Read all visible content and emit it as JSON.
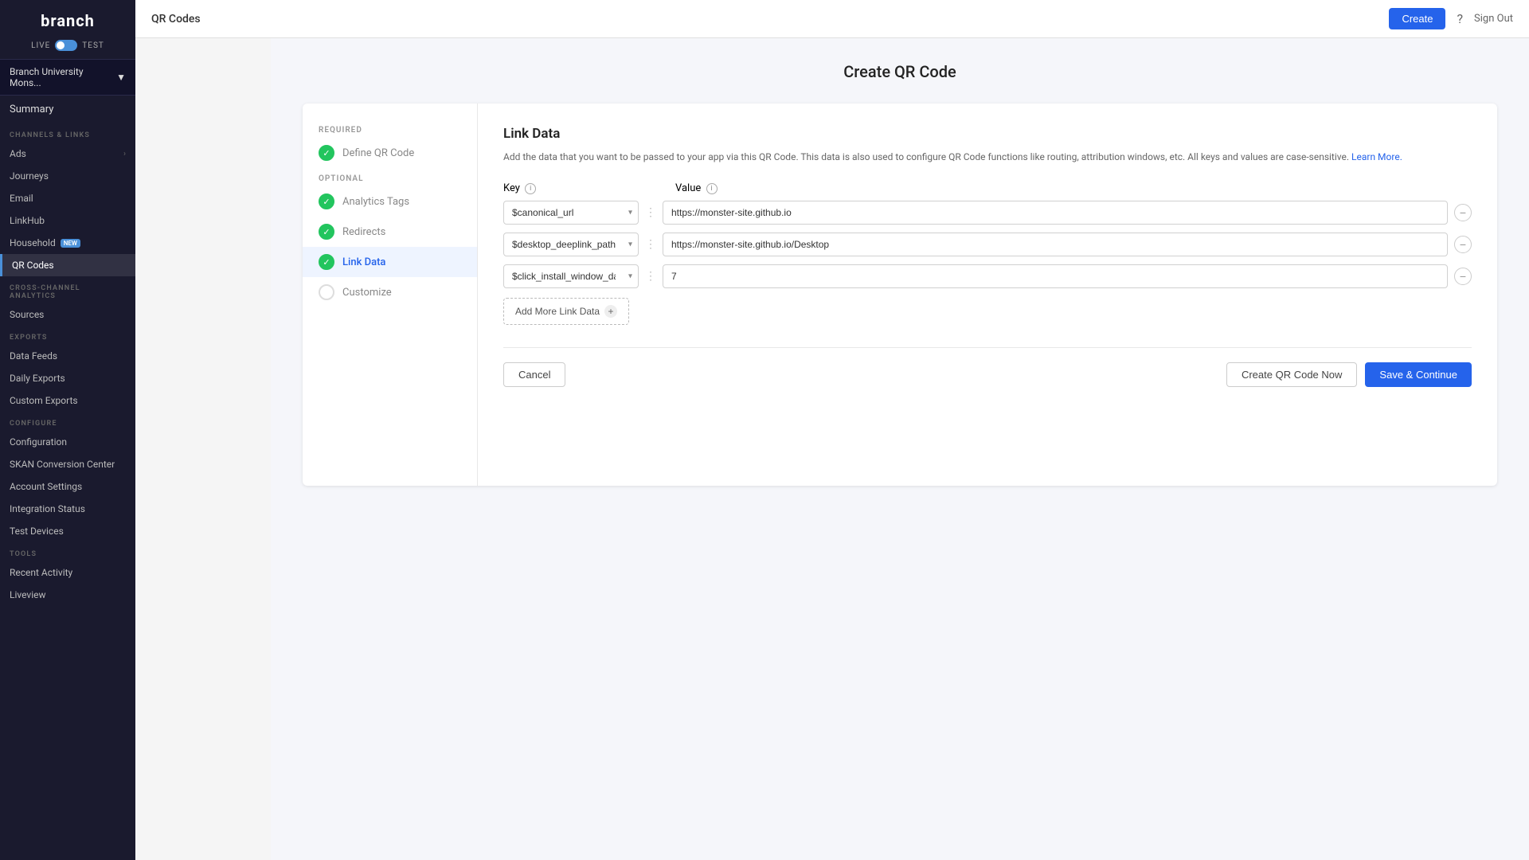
{
  "app": {
    "logo": "branch",
    "logo_sub": "",
    "toggle_live": "LIVE",
    "toggle_test": "TEST"
  },
  "workspace": {
    "name": "Branch University Mons...",
    "chevron": "▼"
  },
  "sidebar": {
    "summary_label": "Summary",
    "channels_links_label": "CHANNELS & LINKS",
    "ads_label": "Ads",
    "journeys_label": "Journeys",
    "email_label": "Email",
    "linkhub_label": "LinkHub",
    "household_label": "Household",
    "household_badge": "NEW",
    "qr_codes_label": "QR Codes",
    "cross_channel_label": "CROSS-CHANNEL ANALYTICS",
    "sources_label": "Sources",
    "exports_label": "EXPORTS",
    "data_feeds_label": "Data Feeds",
    "daily_exports_label": "Daily Exports",
    "custom_exports_label": "Custom Exports",
    "configure_label": "CONFIGURE",
    "configuration_label": "Configuration",
    "skan_label": "SKAN Conversion Center",
    "account_settings_label": "Account Settings",
    "integration_status_label": "Integration Status",
    "test_devices_label": "Test Devices",
    "tools_label": "TOOLS",
    "recent_activity_label": "Recent Activity",
    "liveview_label": "Liveview"
  },
  "topbar": {
    "page_title": "QR Codes",
    "create_btn": "Create",
    "signout_label": "Sign Out"
  },
  "page": {
    "title": "Create QR Code"
  },
  "wizard": {
    "required_label": "REQUIRED",
    "optional_label": "OPTIONAL",
    "steps": [
      {
        "id": "define",
        "label": "Define QR Code",
        "status": "completed"
      },
      {
        "id": "analytics",
        "label": "Analytics Tags",
        "status": "completed"
      },
      {
        "id": "redirects",
        "label": "Redirects",
        "status": "completed"
      },
      {
        "id": "link_data",
        "label": "Link Data",
        "status": "active"
      },
      {
        "id": "customize",
        "label": "Customize",
        "status": "empty"
      }
    ],
    "content": {
      "title": "Link Data",
      "description": "Add the data that you want to be passed to your app via this QR Code. This data is also used to configure QR Code functions like routing, attribution windows, etc. All keys and values are case-sensitive.",
      "learn_more": "Learn More.",
      "key_header": "Key",
      "value_header": "Value",
      "rows": [
        {
          "key": "$canonical_url",
          "value": "https://monster-site.github.io"
        },
        {
          "key": "$desktop_deeplink_path",
          "value": "https://monster-site.github.io/Desktop"
        },
        {
          "key": "$click_install_window_days",
          "value": "7"
        }
      ],
      "add_more_label": "Add More Link Data"
    },
    "footer": {
      "cancel_label": "Cancel",
      "create_now_label": "Create QR Code Now",
      "save_continue_label": "Save & Continue"
    }
  }
}
